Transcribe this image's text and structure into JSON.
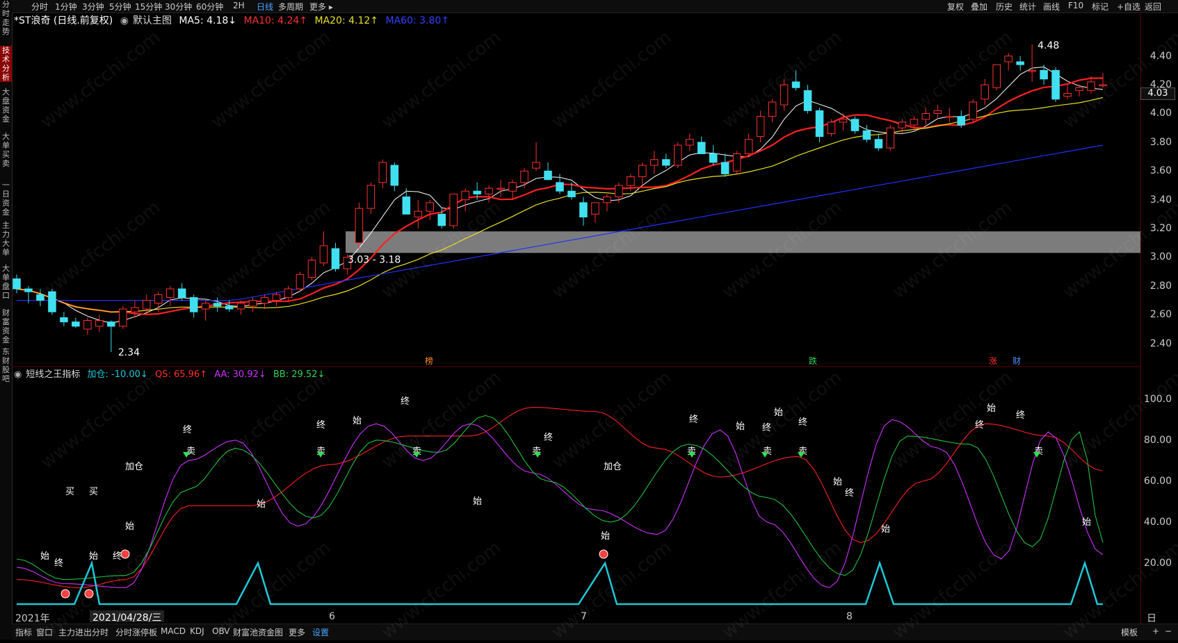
{
  "left_rail": [
    {
      "label": "分时走势",
      "active": false
    },
    {
      "label": "技术分析",
      "active": true
    },
    {
      "label": "大盘资金",
      "active": false
    },
    {
      "label": "大单买卖",
      "active": false
    },
    {
      "label": "一日资金",
      "active": false
    },
    {
      "label": "主力大单",
      "active": false
    },
    {
      "label": "大单盘口",
      "active": false
    },
    {
      "label": "财富资金",
      "active": false
    },
    {
      "label": "东财股吧",
      "active": false
    }
  ],
  "top_bar": {
    "periods": [
      "分时",
      "1分钟",
      "3分钟",
      "5分钟",
      "15分钟",
      "30分钟",
      "60分钟",
      "2H",
      "日线",
      "多周期",
      "更多 ▸"
    ],
    "active_period": "日线",
    "right_items": [
      "复权",
      "叠加",
      "历史",
      "统计",
      "画线",
      "F10",
      "标记",
      "+自选",
      "返回"
    ]
  },
  "main_chart": {
    "title": "*ST浪奇 (日线.前复权)",
    "template": "默认主图",
    "ma5": "MA5: 4.18↓",
    "ma10": "MA10: 4.24↑",
    "ma20": "MA20: 4.12↑",
    "ma60": "MA60: 3.80↑",
    "y_ticks": [
      "4.40",
      "4.20",
      "4.00",
      "3.80",
      "3.60",
      "3.40",
      "3.20",
      "3.00",
      "2.80",
      "2.60",
      "2.40"
    ],
    "current_price": "4.03",
    "high_label": "4.48",
    "low_label": "2.34",
    "zone_label": "3.03 - 3.18",
    "markers": [
      "榜",
      "跌",
      "涨",
      "财"
    ]
  },
  "indicator": {
    "name": "短线之王指标",
    "jiacang": "加仓: -10.00↓",
    "qs": "QS: 65.96↑",
    "aa": "AA: 30.92↓",
    "bb": "BB: 29.52↓",
    "y_ticks": [
      "100.0",
      "80.00",
      "60.00",
      "40.00",
      "20.00"
    ],
    "labels": {
      "shi": "始",
      "zhong": "终",
      "mai": "卖",
      "mai_buy": "买",
      "jiacang": "加仓"
    }
  },
  "date_axis": {
    "year": "2021年",
    "cursor": "2021/04/28/三",
    "months": [
      "6",
      "7",
      "8"
    ],
    "period": "日线"
  },
  "bottom_bar": {
    "items": [
      "指标",
      "窗口",
      "主力进出分时",
      "分时涨停板",
      "MACD",
      "KDJ",
      "OBV",
      "财富池资金图",
      "更多",
      "设置"
    ],
    "active": "设置",
    "right_items": [
      "模板",
      "+",
      "−"
    ]
  },
  "watermark": "www.cfcchi.com",
  "colors": {
    "up": "#ff3030",
    "down": "#40e0f0",
    "ma5": "#ffffff",
    "ma10": "#ff2020",
    "ma20": "#e8e020",
    "ma60": "#2030ff",
    "qs": "#ff2020",
    "aa": "#d030ff",
    "bb": "#20c040",
    "signal": "#20c8d8"
  },
  "chart_data": [
    {
      "type": "candlestick",
      "title": "*ST浪奇 (日线.前复权)",
      "ylim": [
        2.3,
        4.55
      ],
      "ohlc": [
        [
          2.85,
          2.88,
          2.75,
          2.78
        ],
        [
          2.78,
          2.8,
          2.68,
          2.76
        ],
        [
          2.74,
          2.78,
          2.66,
          2.7
        ],
        [
          2.76,
          2.78,
          2.6,
          2.62
        ],
        [
          2.58,
          2.62,
          2.52,
          2.55
        ],
        [
          2.55,
          2.58,
          2.51,
          2.52
        ],
        [
          2.5,
          2.58,
          2.46,
          2.56
        ],
        [
          2.52,
          2.6,
          2.48,
          2.56
        ],
        [
          2.55,
          2.56,
          2.34,
          2.52
        ],
        [
          2.52,
          2.66,
          2.5,
          2.64
        ],
        [
          2.62,
          2.7,
          2.58,
          2.65
        ],
        [
          2.64,
          2.74,
          2.6,
          2.7
        ],
        [
          2.68,
          2.76,
          2.62,
          2.74
        ],
        [
          2.72,
          2.8,
          2.66,
          2.78
        ],
        [
          2.78,
          2.82,
          2.7,
          2.72
        ],
        [
          2.72,
          2.74,
          2.58,
          2.62
        ],
        [
          2.64,
          2.7,
          2.56,
          2.68
        ],
        [
          2.68,
          2.72,
          2.62,
          2.66
        ],
        [
          2.66,
          2.7,
          2.62,
          2.64
        ],
        [
          2.64,
          2.7,
          2.6,
          2.68
        ],
        [
          2.66,
          2.72,
          2.62,
          2.7
        ],
        [
          2.68,
          2.74,
          2.64,
          2.72
        ],
        [
          2.7,
          2.76,
          2.66,
          2.74
        ],
        [
          2.72,
          2.8,
          2.7,
          2.78
        ],
        [
          2.78,
          2.9,
          2.76,
          2.88
        ],
        [
          2.86,
          3.0,
          2.84,
          2.98
        ],
        [
          2.96,
          3.18,
          2.94,
          3.08
        ],
        [
          3.06,
          3.1,
          2.9,
          2.92
        ],
        [
          2.92,
          3.02,
          2.88,
          3.0
        ],
        [
          3.1,
          3.38,
          3.06,
          3.34
        ],
        [
          3.34,
          3.52,
          3.3,
          3.5
        ],
        [
          3.52,
          3.68,
          3.48,
          3.66
        ],
        [
          3.64,
          3.66,
          3.46,
          3.5
        ],
        [
          3.42,
          3.48,
          3.3,
          3.3
        ],
        [
          3.28,
          3.4,
          3.2,
          3.32
        ],
        [
          3.32,
          3.4,
          3.26,
          3.38
        ],
        [
          3.3,
          3.34,
          3.2,
          3.22
        ],
        [
          3.22,
          3.4,
          3.2,
          3.44
        ],
        [
          3.4,
          3.48,
          3.32,
          3.46
        ],
        [
          3.46,
          3.52,
          3.4,
          3.44
        ],
        [
          3.44,
          3.5,
          3.38,
          3.48
        ],
        [
          3.48,
          3.54,
          3.42,
          3.48
        ],
        [
          3.46,
          3.54,
          3.4,
          3.52
        ],
        [
          3.52,
          3.62,
          3.48,
          3.6
        ],
        [
          3.62,
          3.8,
          3.6,
          3.66
        ],
        [
          3.6,
          3.66,
          3.54,
          3.54
        ],
        [
          3.52,
          3.58,
          3.44,
          3.46
        ],
        [
          3.46,
          3.52,
          3.4,
          3.42
        ],
        [
          3.38,
          3.42,
          3.22,
          3.28
        ],
        [
          3.3,
          3.36,
          3.24,
          3.38
        ],
        [
          3.38,
          3.44,
          3.32,
          3.42
        ],
        [
          3.42,
          3.52,
          3.38,
          3.5
        ],
        [
          3.5,
          3.58,
          3.46,
          3.56
        ],
        [
          3.56,
          3.66,
          3.5,
          3.64
        ],
        [
          3.64,
          3.74,
          3.58,
          3.68
        ],
        [
          3.68,
          3.72,
          3.62,
          3.64
        ],
        [
          3.64,
          3.8,
          3.62,
          3.78
        ],
        [
          3.78,
          3.86,
          3.74,
          3.82
        ],
        [
          3.8,
          3.84,
          3.72,
          3.72
        ],
        [
          3.72,
          3.78,
          3.64,
          3.66
        ],
        [
          3.66,
          3.72,
          3.56,
          3.58
        ],
        [
          3.6,
          3.74,
          3.58,
          3.72
        ],
        [
          3.72,
          3.86,
          3.7,
          3.82
        ],
        [
          3.84,
          4.02,
          3.8,
          3.98
        ],
        [
          3.98,
          4.1,
          3.94,
          4.08
        ],
        [
          4.06,
          4.24,
          4.02,
          4.2
        ],
        [
          4.22,
          4.3,
          4.16,
          4.18
        ],
        [
          4.16,
          4.2,
          4.0,
          4.02
        ],
        [
          4.02,
          4.04,
          3.8,
          3.84
        ],
        [
          3.86,
          3.96,
          3.84,
          3.94
        ],
        [
          3.94,
          4.0,
          3.88,
          3.96
        ],
        [
          3.96,
          3.98,
          3.86,
          3.88
        ],
        [
          3.88,
          3.92,
          3.8,
          3.82
        ],
        [
          3.82,
          3.86,
          3.74,
          3.76
        ],
        [
          3.76,
          3.92,
          3.74,
          3.9
        ],
        [
          3.9,
          3.96,
          3.86,
          3.94
        ],
        [
          3.92,
          3.98,
          3.88,
          3.96
        ],
        [
          3.96,
          4.04,
          3.92,
          4.0
        ],
        [
          4.0,
          4.06,
          3.96,
          4.02
        ],
        [
          3.98,
          4.04,
          3.94,
          3.98
        ],
        [
          3.98,
          4.02,
          3.9,
          3.92
        ],
        [
          3.96,
          4.1,
          3.94,
          4.08
        ],
        [
          4.1,
          4.24,
          4.06,
          4.2
        ],
        [
          4.18,
          4.34,
          4.16,
          4.34
        ],
        [
          4.36,
          4.42,
          4.3,
          4.4
        ],
        [
          4.36,
          4.4,
          4.3,
          4.34
        ],
        [
          4.3,
          4.48,
          4.22,
          4.3
        ],
        [
          4.3,
          4.34,
          4.2,
          4.24
        ],
        [
          4.3,
          4.32,
          4.08,
          4.1
        ],
        [
          4.12,
          4.2,
          4.1,
          4.14
        ],
        [
          4.16,
          4.2,
          4.12,
          4.18
        ],
        [
          4.16,
          4.26,
          4.14,
          4.22
        ],
        [
          4.2,
          4.28,
          4.18,
          4.2
        ]
      ]
    }
  ]
}
